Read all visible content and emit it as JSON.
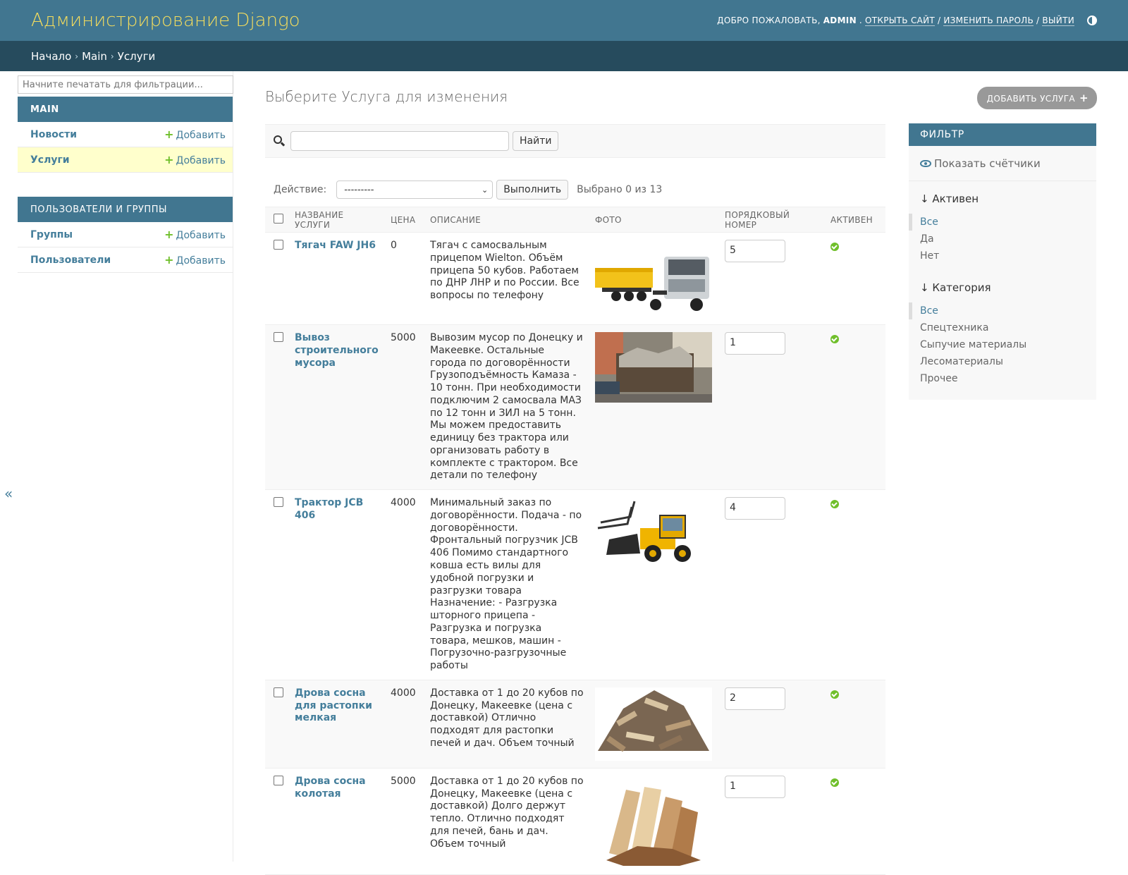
{
  "header": {
    "branding": "Администрирование Django",
    "welcome": "ДОБРО ПОЖАЛОВАТЬ,",
    "username": "ADMIN",
    "links": [
      "ОТКРЫТЬ САЙТ",
      "ИЗМЕНИТЬ ПАРОЛЬ",
      "ВЫЙТИ"
    ],
    "separator": "/",
    "theme_icon": "theme-toggle-icon"
  },
  "breadcrumbs": {
    "home": "Начало",
    "app": "Main",
    "current": "Услуги",
    "sep": "›"
  },
  "sidebar": {
    "filter_placeholder": "Начните печатать для фильтрации...",
    "modules": [
      {
        "caption": "MAIN",
        "items": [
          {
            "name": "Новости",
            "add": "Добавить"
          },
          {
            "name": "Услуги",
            "add": "Добавить"
          }
        ]
      },
      {
        "caption": "ПОЛЬЗОВАТЕЛИ И ГРУППЫ",
        "items": [
          {
            "name": "Группы",
            "add": "Добавить"
          },
          {
            "name": "Пользователи",
            "add": "Добавить"
          }
        ]
      }
    ],
    "toggle": "«"
  },
  "content": {
    "title": "Выберите Услуга для изменения",
    "add_button": "ДОБАВИТЬ УСЛУГА",
    "search_button": "Найти",
    "action_label": "Действие:",
    "action_value": "---------",
    "execute_button": "Выполнить",
    "selected_count": "Выбрано 0 из 13",
    "columns": [
      "НАЗВАНИЕ УСЛУГИ",
      "ЦЕНА",
      "ОПИСАНИЕ",
      "ФОТО",
      "ПОРЯДКОВЫЙ НОМЕР",
      "АКТИВЕН"
    ],
    "rows": [
      {
        "name": "Тягач FAW JH6",
        "price": "0",
        "description": "Тягач с самосвальным прицепом Wielton. Объём прицепа 50 кубов. Работаем по ДНР ЛНР и по России. Все вопросы по телефону",
        "order": "5",
        "photo": "truck-photo",
        "active": true
      },
      {
        "name": "Вывоз строительного мусора",
        "price": "5000",
        "description": "Вывозим мусор по Донецку и Макеевке. Остальные города по договорённости Грузоподъёмность Камаза - 10 тонн. При необходимости подключим 2 самосвала МАЗ по 12 тонн и ЗИЛ на 5 тонн. Мы можем предоставить единицу без трактора или организовать работу в комплекте с трактором. Все детали по телефону",
        "order": "1",
        "photo": "debris-container-photo",
        "active": true
      },
      {
        "name": "Трактор JCB 406",
        "price": "4000",
        "description": "Минимальный заказ по договорённости. Подача - по договорённости. Фронтальный погрузчик JCB 406 Помимо стандартного ковша есть вилы для удобной погрузки и разгрузки товара Назначение: - Разгрузка шторного прицепа - Разгрузка и погрузка товара, мешков, машин - Погрузочно-разгрузочные работы",
        "order": "4",
        "photo": "loader-photo",
        "active": true
      },
      {
        "name": "Дрова сосна для растопки мелкая",
        "price": "4000",
        "description": "Доставка от 1 до 20 кубов по Донецку, Макеевке (цена с доставкой) Отлично подходят для растопки печей и дач. Объем точный",
        "order": "2",
        "photo": "kindling-photo",
        "active": true
      },
      {
        "name": "Дрова сосна колотая",
        "price": "5000",
        "description": "Доставка от 1 до 20 кубов по Донецку, Макеевке (цена с доставкой) Долго держут тепло. Отлично подходят для печей, бань и дач. Объем точный",
        "order": "1",
        "photo": "split-firewood-photo",
        "active": true
      }
    ]
  },
  "filter": {
    "title": "ФИЛЬТР",
    "show_counts": "Показать счётчики",
    "groups": [
      {
        "title": "↓ Активен",
        "options": [
          "Все",
          "Да",
          "Нет"
        ],
        "selected": "Все"
      },
      {
        "title": "↓ Категория",
        "options": [
          "Все",
          "Спецтехника",
          "Сыпучие материалы",
          "Лесоматериалы",
          "Прочее"
        ],
        "selected": "Все"
      }
    ]
  },
  "colors": {
    "header_bg": "#417690",
    "breadcrumbs_bg": "#264b5d",
    "branding": "#f5dd5d",
    "link": "#447e9b",
    "add_green": "#70bf2b",
    "active_row": "#ffffcc"
  }
}
